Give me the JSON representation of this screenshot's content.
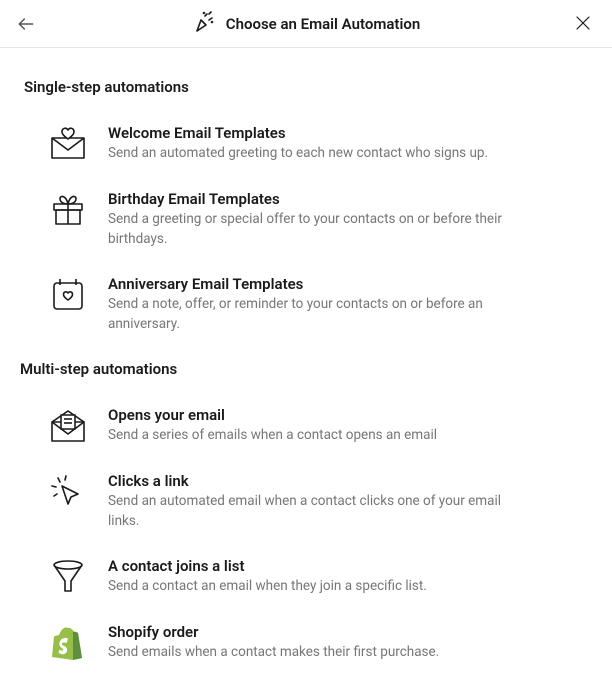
{
  "header": {
    "title": "Choose an Email Automation"
  },
  "sections": {
    "single": {
      "title": "Single-step automations",
      "items": [
        {
          "title": "Welcome Email Templates",
          "desc": "Send an automated greeting to each new contact who signs up."
        },
        {
          "title": "Birthday Email Templates",
          "desc": "Send a greeting or special offer to your contacts on or before their birthdays."
        },
        {
          "title": "Anniversary Email Templates",
          "desc": "Send a note, offer, or reminder to your contacts on or before an anniversary."
        }
      ]
    },
    "multi": {
      "title": "Multi-step automations",
      "items": [
        {
          "title": "Opens your email",
          "desc": "Send a series of emails when a contact opens an email"
        },
        {
          "title": "Clicks a link",
          "desc": "Send an automated email when a contact clicks one of your email links."
        },
        {
          "title": "A contact joins a list",
          "desc": "Send a contact an email when they join a specific list."
        },
        {
          "title": "Shopify order",
          "desc": "Send emails when a contact makes their first purchase."
        }
      ]
    }
  }
}
